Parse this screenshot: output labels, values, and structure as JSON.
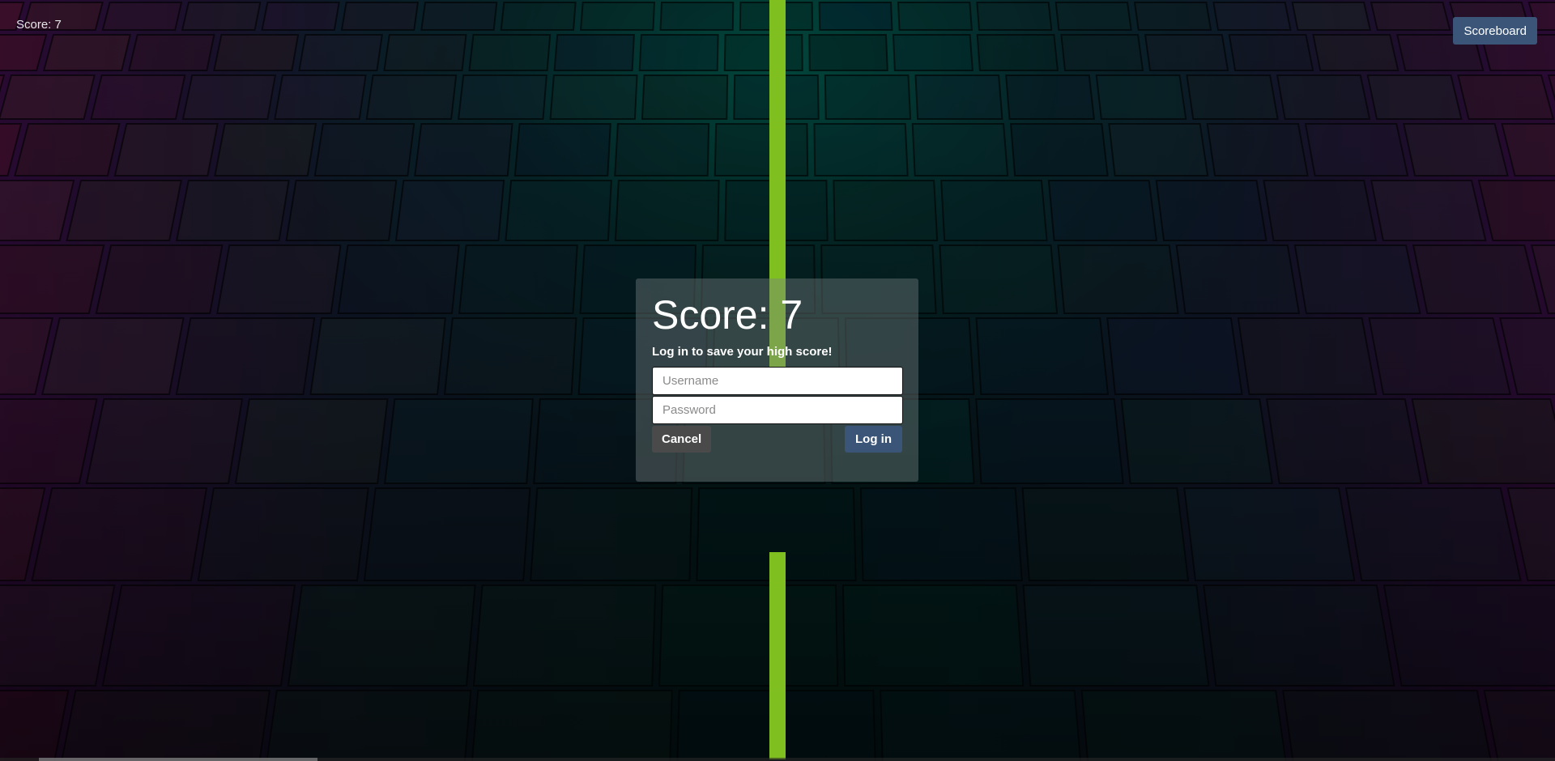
{
  "hud": {
    "score_text": "Score: 7",
    "scoreboard_label": "Scoreboard"
  },
  "dialog": {
    "title": "Score: 7",
    "subtitle": "Log in to save your high score!",
    "username_placeholder": "Username",
    "password_placeholder": "Password",
    "cancel_label": "Cancel",
    "login_label": "Log in"
  },
  "colors": {
    "pipe": "#7fbf1f",
    "primary_button": "#3a5578",
    "cancel_button": "#4a4a4a"
  }
}
